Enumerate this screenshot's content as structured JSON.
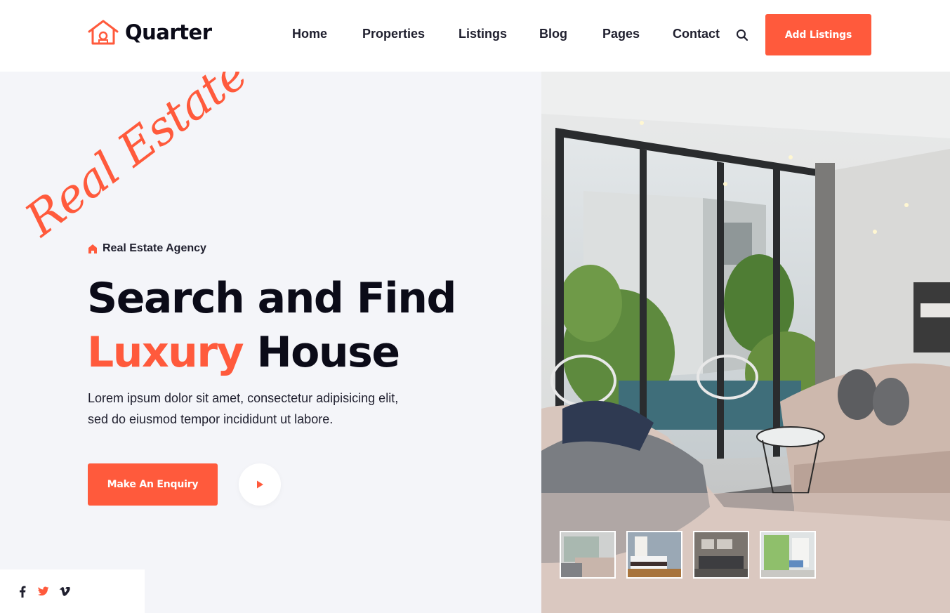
{
  "brand": {
    "name": "Quarter",
    "accent": "#ff5a3c",
    "dark": "#0b0b18"
  },
  "nav": {
    "items": [
      "Home",
      "Properties",
      "Listings",
      "Blog",
      "Pages",
      "Contact"
    ],
    "search_icon": "search-icon",
    "cta": "Add Listings"
  },
  "hero": {
    "script_text": "Real Estate",
    "tagline": "Real Estate Agency",
    "headline_line1": "Search and Find",
    "headline_accent": "Luxury",
    "headline_rest": " House",
    "description_line1": "Lorem ipsum dolor sit amet, consectetur adipisicing elit,",
    "description_line2": "sed do eiusmod tempor incididunt ut labore.",
    "cta": "Make An Enquiry",
    "play_icon": "play-icon"
  },
  "social": [
    "facebook-icon",
    "twitter-icon",
    "vimeo-icon"
  ],
  "gallery": {
    "thumbnails": [
      "living-room-thumb",
      "bedroom-thumb",
      "lounge-thumb",
      "balcony-thumb"
    ],
    "selected": 0
  }
}
